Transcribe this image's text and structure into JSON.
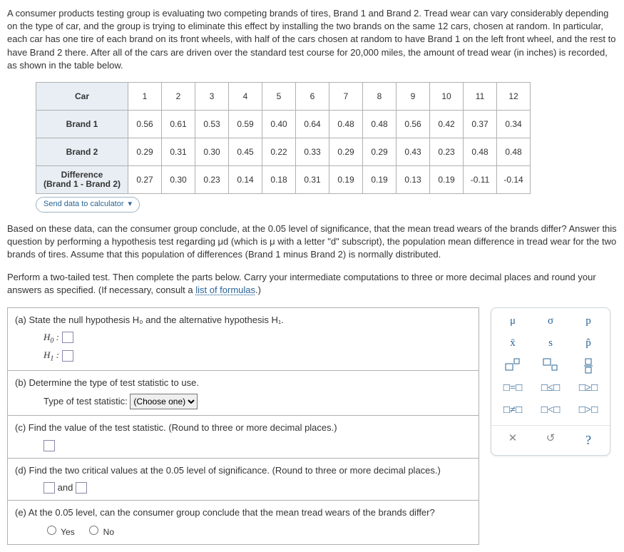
{
  "intro": "A consumer products testing group is evaluating two competing brands of tires, Brand 1 and Brand 2. Tread wear can vary considerably depending on the type of car, and the group is trying to eliminate this effect by installing the two brands on the same 12 cars, chosen at random. In particular, each car has one tire of each brand on its front wheels, with half of the cars chosen at random to have Brand 1 on the left front wheel, and the rest to have Brand 2 there. After all of the cars are driven over the standard test course for 20,000 miles, the amount of tread wear (in inches) is recorded, as shown in the table below.",
  "table": {
    "headers": {
      "car": "Car",
      "b1": "Brand 1",
      "b2": "Brand 2",
      "diff_l1": "Difference",
      "diff_l2": "(Brand 1 - Brand 2)"
    },
    "cols": [
      "1",
      "2",
      "3",
      "4",
      "5",
      "6",
      "7",
      "8",
      "9",
      "10",
      "11",
      "12"
    ],
    "b1": [
      "0.56",
      "0.61",
      "0.53",
      "0.59",
      "0.40",
      "0.64",
      "0.48",
      "0.48",
      "0.56",
      "0.42",
      "0.37",
      "0.34"
    ],
    "b2": [
      "0.29",
      "0.31",
      "0.30",
      "0.45",
      "0.22",
      "0.33",
      "0.29",
      "0.29",
      "0.43",
      "0.23",
      "0.48",
      "0.48"
    ],
    "diff": [
      "0.27",
      "0.30",
      "0.23",
      "0.14",
      "0.18",
      "0.31",
      "0.19",
      "0.19",
      "0.13",
      "0.19",
      "-0.11",
      "-0.14"
    ]
  },
  "send_link": "Send data to calculator",
  "prompt1": "Based on these data, can the consumer group conclude, at the 0.05 level of significance, that the mean tread wears of the brands differ? Answer this question by performing a hypothesis test regarding μd (which is μ with a letter \"d\" subscript), the population mean difference in tread wear for the two brands of tires. Assume that this population of differences (Brand 1 minus Brand 2) is normally distributed.",
  "prompt2_a": "Perform a two-tailed test. Then complete the parts below. Carry your intermediate computations to three or more decimal places and round your answers as specified. (If necessary, consult a ",
  "prompt2_link": "list of formulas",
  "prompt2_b": ".)",
  "parts": {
    "a_label": "(a)  State the null hypothesis H₀ and the alternative hypothesis H₁.",
    "h0": "H₀ :",
    "h1": "H₁ :",
    "b_label": "(b)  Determine the type of test statistic to use.",
    "b_type_label": "Type of test statistic:",
    "b_choose": "(Choose one)",
    "c_label": "(c)  Find the value of the test statistic. (Round to three or more decimal places.)",
    "d_label": "(d)  Find the two critical values at the 0.05 level of significance. (Round to three or more decimal places.)",
    "d_and": "and",
    "e_label": "(e)  At the 0.05 level, can the consumer group conclude that the mean tread wears of the brands differ?",
    "yes": "Yes",
    "no": "No"
  },
  "palette": {
    "r1": {
      "a": "μ",
      "b": "σ",
      "c": "p"
    },
    "r2": {
      "a": "x̄",
      "b": "s",
      "c": "p̂"
    },
    "r4": {
      "a": "□=□",
      "b": "□≤□",
      "c": "□≥□"
    },
    "r5": {
      "a": "□≠□",
      "b": "□<□",
      "c": "□>□"
    },
    "r6": {
      "b_title": "reset",
      "c": "?"
    }
  },
  "chart_data": {
    "type": "table",
    "title": "Tread wear (inches)",
    "columns": [
      "Car",
      "Brand 1",
      "Brand 2",
      "Difference (Brand 1 - Brand 2)"
    ],
    "rows": [
      [
        1,
        0.56,
        0.29,
        0.27
      ],
      [
        2,
        0.61,
        0.31,
        0.3
      ],
      [
        3,
        0.53,
        0.3,
        0.23
      ],
      [
        4,
        0.59,
        0.45,
        0.14
      ],
      [
        5,
        0.4,
        0.22,
        0.18
      ],
      [
        6,
        0.64,
        0.33,
        0.31
      ],
      [
        7,
        0.48,
        0.29,
        0.19
      ],
      [
        8,
        0.48,
        0.29,
        0.19
      ],
      [
        9,
        0.56,
        0.43,
        0.13
      ],
      [
        10,
        0.42,
        0.23,
        0.19
      ],
      [
        11,
        0.37,
        0.48,
        -0.11
      ],
      [
        12,
        0.34,
        0.48,
        -0.14
      ]
    ]
  }
}
